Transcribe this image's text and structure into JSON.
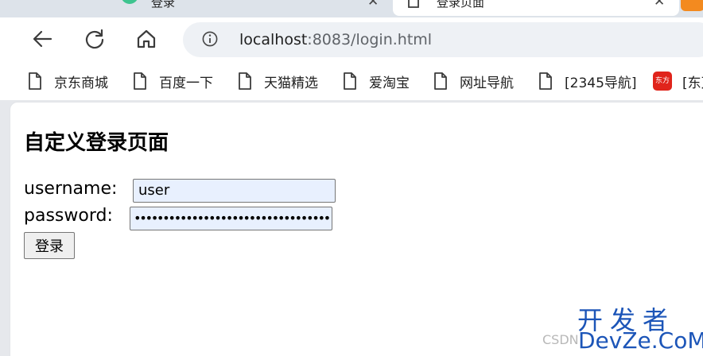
{
  "tabs": [
    {
      "label": "登录",
      "active": false
    },
    {
      "label": "登录页面",
      "active": true
    }
  ],
  "toolbar": {
    "back_icon": "arrow-left-icon",
    "reload_icon": "reload-icon",
    "home_icon": "home-icon",
    "site_info_icon": "info-circle-icon",
    "url_host": "localhost",
    "url_rest": ":8083/login.html"
  },
  "bookmarks": [
    {
      "label": "京东商城",
      "icon": "page-icon"
    },
    {
      "label": "百度一下",
      "icon": "page-icon"
    },
    {
      "label": "天猫精选",
      "icon": "page-icon"
    },
    {
      "label": "爱淘宝",
      "icon": "page-icon"
    },
    {
      "label": "网址导航",
      "icon": "page-icon"
    },
    {
      "label": "[2345导航]",
      "icon": "page-icon"
    },
    {
      "label": "[东万",
      "icon": "site-favicon",
      "icon_text": "东方"
    }
  ],
  "page": {
    "title": "自定义登录页面",
    "username_label": "username:",
    "username_value": "user",
    "password_label": "password:",
    "password_masked": "••••••••••••••••••••••••••••••••••",
    "login_button": "登录"
  },
  "watermark": {
    "main": "开发者",
    "domain": "DevZe.CoM",
    "source": "CSDN"
  },
  "colors": {
    "tab_strip": "#dde3ea",
    "omnibox": "#eef1f5",
    "input_autofill": "#e8f0fe",
    "watermark": "#1c55b8"
  }
}
